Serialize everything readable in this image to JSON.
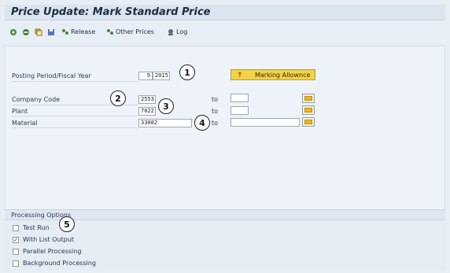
{
  "header": {
    "title": "Price Update: Mark Standard Price"
  },
  "toolbar": {
    "icons": [
      "execute-icon",
      "refresh-icon",
      "copy-icon",
      "save-icon"
    ],
    "release_label": "Release",
    "other_prices_label": "Other Prices",
    "log_label": "Log"
  },
  "selection": {
    "posting_period_label": "Posting Period/Fiscal Year",
    "posting_period_value": "9",
    "fiscal_year_value": "2015",
    "marking_allowance_label": "Marking Allownce",
    "company_code_label": "Company Code",
    "company_code_value": "2553",
    "plant_label": "Plant",
    "plant_value": "7022",
    "material_label": "Material",
    "material_value": "33082",
    "to_label": "to"
  },
  "processing": {
    "title": "Processing Options",
    "options": [
      {
        "label": "Test Run",
        "checked": false
      },
      {
        "label": "With List Output",
        "checked": true
      },
      {
        "label": "Parallel Processing",
        "checked": false
      },
      {
        "label": "Background Processing",
        "checked": false
      }
    ]
  },
  "callouts": [
    "1",
    "2",
    "3",
    "4",
    "5"
  ],
  "colors": {
    "accent": "#f3d24a",
    "title": "#1c2c44",
    "background": "#e8eef6"
  }
}
